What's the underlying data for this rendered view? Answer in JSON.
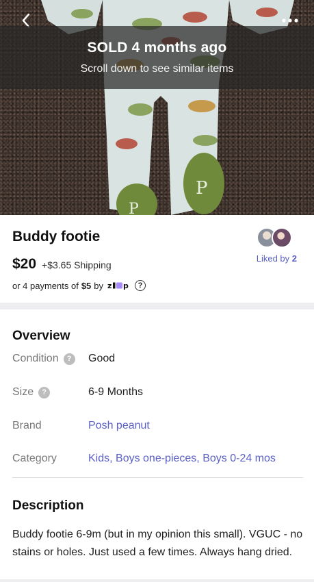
{
  "banner": {
    "sold_text": "SOLD 4 months ago",
    "subtitle": "Scroll down to see similar items"
  },
  "listing": {
    "title": "Buddy footie",
    "price": "$20",
    "shipping": "+$3.65 Shipping",
    "installments": {
      "prefix": "or 4 payments of",
      "amount": "$5",
      "by": "by",
      "provider": "zip",
      "help": "?"
    },
    "liked_by_label": "Liked by",
    "liked_by_count": "2"
  },
  "overview": {
    "title": "Overview",
    "rows": [
      {
        "label": "Condition",
        "value": "Good"
      },
      {
        "label": "Size",
        "value": "6-9 Months"
      },
      {
        "label": "Brand",
        "value": "Posh peanut"
      },
      {
        "label": "Category",
        "value": "Kids, Boys one-pieces, Boys 0-24 mos"
      }
    ]
  },
  "description": {
    "title": "Description",
    "text": "Buddy footie 6-9m (but in my opinion this small). VGUC - no stains or holes. Just used a few times. Always hang dried."
  },
  "icons": {
    "back": "chevron-left-icon",
    "more": "more-dots-icon",
    "help": "question-circle-icon"
  },
  "colors": {
    "link": "#5a5fc4",
    "banner_bg": "rgba(40,40,40,0.72)",
    "zip_accent": "#a78bfa"
  }
}
